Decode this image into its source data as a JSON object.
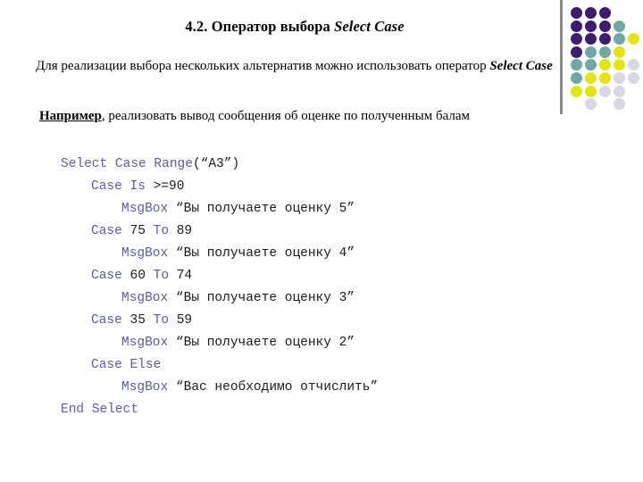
{
  "slide": {
    "title_main": "4.2. Оператор выбора ",
    "title_emphasis": "Select Case",
    "intro_text": "Для реализации выбора нескольких альтернатив можно использовать оператор ",
    "intro_emphasis": "Select Case",
    "example_label": "Например",
    "example_text": ", реализовать вывод сообщения об оценке по полученным балам"
  },
  "code": {
    "language": "VBA",
    "lines": [
      {
        "indent": 0,
        "keyword": "Select Case Range",
        "rest": "(“A3”)"
      },
      {
        "indent": 1,
        "keyword": "Case Is",
        "rest": " >=90"
      },
      {
        "indent": 2,
        "keyword": "MsgBox",
        "rest": " “Вы получаете оценку 5”"
      },
      {
        "indent": 1,
        "keyword": "Case",
        "rest": " 75 ",
        "keyword2": "To",
        "rest2": " 89"
      },
      {
        "indent": 2,
        "keyword": "MsgBox",
        "rest": " “Вы получаете оценку 4”"
      },
      {
        "indent": 1,
        "keyword": "Case",
        "rest": " 60 ",
        "keyword2": "To",
        "rest2": " 74"
      },
      {
        "indent": 2,
        "keyword": "MsgBox",
        "rest": " “Вы получаете оценку 3”"
      },
      {
        "indent": 1,
        "keyword": "Case",
        "rest": " 35 ",
        "keyword2": "To",
        "rest2": " 59"
      },
      {
        "indent": 2,
        "keyword": "MsgBox",
        "rest": " “Вы получаете оценку 2”"
      },
      {
        "indent": 1,
        "keyword": "Case Else",
        "rest": ""
      },
      {
        "indent": 2,
        "keyword": "MsgBox",
        "rest": " “Вас необходимо отчислить”"
      },
      {
        "indent": 0,
        "keyword": "End Select",
        "rest": ""
      }
    ]
  },
  "decoration": {
    "divider_color": "#8a8a8a",
    "palette": {
      "purple": "#3b1c6e",
      "teal": "#6fa8a8",
      "yellow": "#e3e315",
      "gray": "#d8d8e4"
    },
    "grid": [
      [
        "purple",
        "purple",
        "purple",
        null,
        null
      ],
      [
        "purple",
        "purple",
        "purple",
        "teal",
        null
      ],
      [
        "purple",
        "purple",
        "purple",
        "teal",
        "yellow"
      ],
      [
        "purple",
        "teal",
        "teal",
        "yellow",
        null
      ],
      [
        "teal",
        "teal",
        "yellow",
        "yellow",
        "gray"
      ],
      [
        "teal",
        "yellow",
        "yellow",
        "gray",
        "gray"
      ],
      [
        "yellow",
        "yellow",
        "gray",
        "gray",
        null
      ],
      [
        null,
        "gray",
        null,
        "gray",
        null
      ]
    ]
  }
}
